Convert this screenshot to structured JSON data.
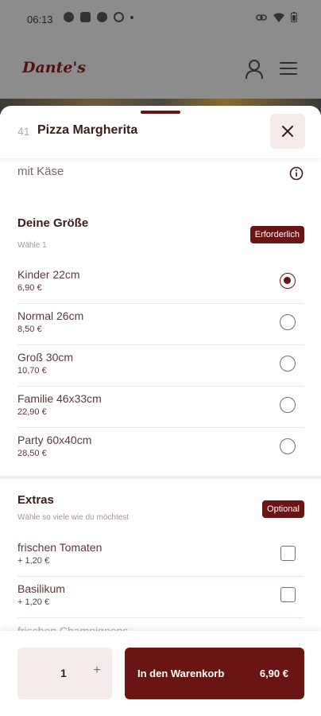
{
  "status_bar": {
    "time": "06:13"
  },
  "app": {
    "logo": "Dante's"
  },
  "sheet": {
    "item_number": "41",
    "item_title": "Pizza Margherita",
    "subtitle": "mit Käse"
  },
  "size_section": {
    "title": "Deine Größe",
    "subtitle": "Wähle 1",
    "badge": "Erforderlich",
    "options": [
      {
        "name": "Kinder 22cm",
        "price": "6,90 €",
        "selected": true
      },
      {
        "name": "Normal 26cm",
        "price": "8,50 €",
        "selected": false
      },
      {
        "name": "Groß 30cm",
        "price": "10,70 €",
        "selected": false
      },
      {
        "name": "Familie 46x33cm",
        "price": "22,90 €",
        "selected": false
      },
      {
        "name": "Party 60x40cm",
        "price": "28,50 €",
        "selected": false
      }
    ]
  },
  "extras_section": {
    "title": "Extras",
    "subtitle": "Wähle so viele wie du möchtest",
    "badge": "Optional",
    "options": [
      {
        "name": "frischen Tomaten",
        "price": "+ 1,20 €",
        "checked": false
      },
      {
        "name": "Basilikum",
        "price": "+ 1,20 €",
        "checked": false
      },
      {
        "name": "frischen Champignons",
        "price": "",
        "checked": false
      }
    ]
  },
  "footer": {
    "quantity": "1",
    "plus": "+",
    "cart_label": "In den Warenkorb",
    "cart_price": "6,90 €"
  },
  "colors": {
    "accent": "#6b1414",
    "close_bg": "#f4ebea",
    "overlay": "#8c8c8c"
  }
}
